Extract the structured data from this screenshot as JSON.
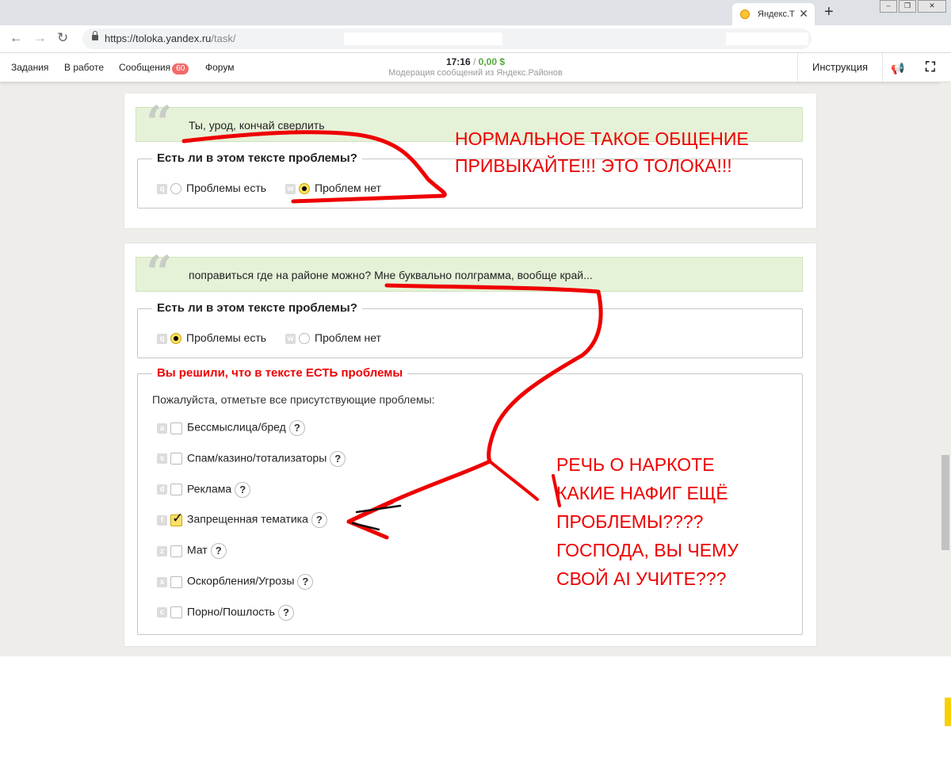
{
  "browser": {
    "tab_title": "Яндекс.Т",
    "url_main": "https://toloka.yandex.ru",
    "url_path": "/task/"
  },
  "header": {
    "menu": [
      "Задания",
      "В работе",
      "Сообщения",
      "Форум"
    ],
    "messages_badge": "60",
    "time": "17:16",
    "balance": "0,00 $",
    "subtitle": "Модерация сообщений из Яндекс.Районов",
    "instruction": "Инструкция"
  },
  "task1": {
    "text": "Ты, урод, кончай сверлить",
    "question": "Есть ли в этом тексте проблемы?",
    "opt_yes": "Проблемы есть",
    "opt_no": "Проблем нет",
    "key_yes": "q",
    "key_no": "w"
  },
  "task2": {
    "text": "поправиться где на районе можно? Мне буквально полграмма, вообще край...",
    "question": "Есть ли в этом тексте проблемы?",
    "opt_yes": "Проблемы есть",
    "opt_no": "Проблем нет",
    "key_yes": "q",
    "key_no": "w",
    "problems_legend": "Вы решили, что в тексте ЕСТЬ проблемы",
    "problems_hint": "Пожалуйста, отметьте все присутствующие проблемы:",
    "problems": [
      {
        "key": "a",
        "label": "Бессмыслица/бред",
        "checked": false
      },
      {
        "key": "s",
        "label": "Спам/казино/тотализаторы",
        "checked": false
      },
      {
        "key": "d",
        "label": "Реклама",
        "checked": false
      },
      {
        "key": "f",
        "label": "Запрещенная тематика",
        "checked": true
      },
      {
        "key": "z",
        "label": "Мат",
        "checked": false
      },
      {
        "key": "x",
        "label": "Оскорбления/Угрозы",
        "checked": false
      },
      {
        "key": "c",
        "label": "Порно/Пошлость",
        "checked": false
      }
    ]
  },
  "annotations": {
    "note1": [
      "НОРМАЛЬНОЕ ТАКОЕ ОБЩЕНИЕ",
      "ПРИВЫКАЙТЕ!!! ЭТО ТОЛОКА!!!"
    ],
    "note2": [
      "РЕЧЬ О НАРКОТЕ",
      "КАКИЕ НАФИГ ЕЩЁ",
      "ПРОБЛЕМЫ????",
      "ГОСПОДА, ВЫ ЧЕМУ",
      "СВОЙ AI УЧИТЕ???"
    ],
    "ink_color": "#e00000"
  }
}
